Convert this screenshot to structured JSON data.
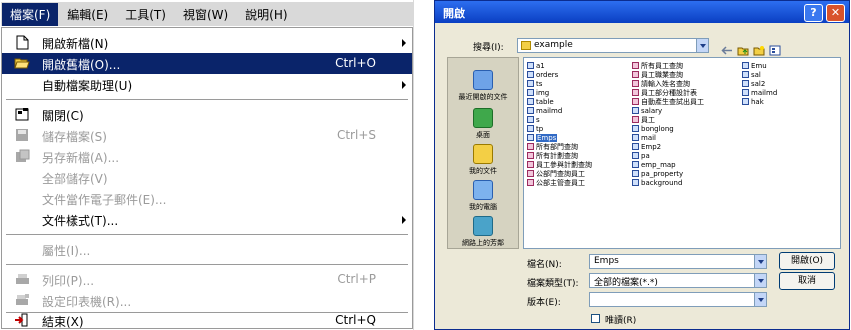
{
  "menu": {
    "menubar": [
      "檔案(F)",
      "編輯(E)",
      "工具(T)",
      "視窗(W)",
      "說明(H)"
    ],
    "items": [
      {
        "label": "開啟新檔(N)",
        "shortcut": "",
        "icon": "new-file-icon",
        "submenu": true,
        "state": "normal"
      },
      {
        "label": "開啟舊檔(O)...",
        "shortcut": "Ctrl+O",
        "icon": "open-folder-icon",
        "submenu": false,
        "state": "highlighted"
      },
      {
        "label": "自動檔案助理(U)",
        "shortcut": "",
        "icon": "",
        "submenu": true,
        "state": "normal"
      },
      {
        "label": "關閉(C)",
        "shortcut": "",
        "icon": "close-document-icon",
        "submenu": false,
        "state": "normal"
      },
      {
        "label": "儲存檔案(S)",
        "shortcut": "Ctrl+S",
        "icon": "save-icon",
        "submenu": false,
        "state": "disabled"
      },
      {
        "label": "另存新檔(A)...",
        "shortcut": "",
        "icon": "save-as-icon",
        "submenu": false,
        "state": "disabled"
      },
      {
        "label": "全部儲存(V)",
        "shortcut": "",
        "icon": "",
        "submenu": false,
        "state": "disabled"
      },
      {
        "label": "文件當作電子郵件(E)...",
        "shortcut": "",
        "icon": "",
        "submenu": false,
        "state": "disabled"
      },
      {
        "label": "文件樣式(T)...",
        "shortcut": "",
        "icon": "",
        "submenu": true,
        "state": "normal"
      },
      {
        "label": "屬性(I)...",
        "shortcut": "",
        "icon": "",
        "submenu": false,
        "state": "disabled"
      },
      {
        "label": "列印(P)...",
        "shortcut": "Ctrl+P",
        "icon": "print-icon",
        "submenu": false,
        "state": "disabled"
      },
      {
        "label": "設定印表機(R)...",
        "shortcut": "",
        "icon": "printer-setup-icon",
        "submenu": false,
        "state": "disabled"
      },
      {
        "label": "結束(X)",
        "shortcut": "Ctrl+Q",
        "icon": "exit-icon",
        "submenu": false,
        "state": "normal"
      }
    ]
  },
  "dialog": {
    "title": "開啟",
    "look_in_label": "搜尋(I):",
    "look_in_value": "example",
    "places": [
      "最近開啟的文件",
      "桌面",
      "我的文件",
      "我的電腦",
      "網路上的芳鄰"
    ],
    "files": [
      {
        "name": "a1",
        "type": "table"
      },
      {
        "name": "orders",
        "type": "table"
      },
      {
        "name": "ts",
        "type": "table"
      },
      {
        "name": "img",
        "type": "table"
      },
      {
        "name": "table",
        "type": "table"
      },
      {
        "name": "mailmd",
        "type": "table"
      },
      {
        "name": "s",
        "type": "table"
      },
      {
        "name": "tp",
        "type": "table"
      },
      {
        "name": "Emps",
        "type": "table",
        "selected": true
      },
      {
        "name": "所有部門查詢",
        "type": "query"
      },
      {
        "name": "所有計劃查詢",
        "type": "query"
      },
      {
        "name": "員工參與計劃查詢",
        "type": "query"
      },
      {
        "name": "公部門查詢員工",
        "type": "query"
      },
      {
        "name": "公部主管查員工",
        "type": "query"
      },
      {
        "name": "所有員工查詢",
        "type": "query"
      },
      {
        "name": "員工職業查詢",
        "type": "query"
      },
      {
        "name": "請輸入姓名查詢",
        "type": "query"
      },
      {
        "name": "員工部分種設計表",
        "type": "query"
      },
      {
        "name": "自動產生查試出員工",
        "type": "query"
      },
      {
        "name": "salary",
        "type": "table"
      },
      {
        "name": "員工",
        "type": "query"
      },
      {
        "name": "bonglong",
        "type": "table"
      },
      {
        "name": "mail",
        "type": "table"
      },
      {
        "name": "Emp2",
        "type": "table"
      },
      {
        "name": "pa",
        "type": "table"
      },
      {
        "name": "emp_map",
        "type": "table"
      },
      {
        "name": "pa_property",
        "type": "table"
      },
      {
        "name": "background",
        "type": "table"
      },
      {
        "name": "Emu",
        "type": "table"
      },
      {
        "name": "sal",
        "type": "table"
      },
      {
        "name": "sal2",
        "type": "table"
      },
      {
        "name": "mailmd",
        "type": "table"
      },
      {
        "name": "hak",
        "type": "table"
      }
    ],
    "filename_label": "檔名(N):",
    "filename_value": "Emps",
    "filetype_label": "檔案類型(T):",
    "filetype_value": "全部的檔案(*.*)",
    "version_label": "版本(E):",
    "version_value": "",
    "readonly_label": "唯讀(R)",
    "open_button": "開啟(O)",
    "cancel_button": "取消"
  }
}
